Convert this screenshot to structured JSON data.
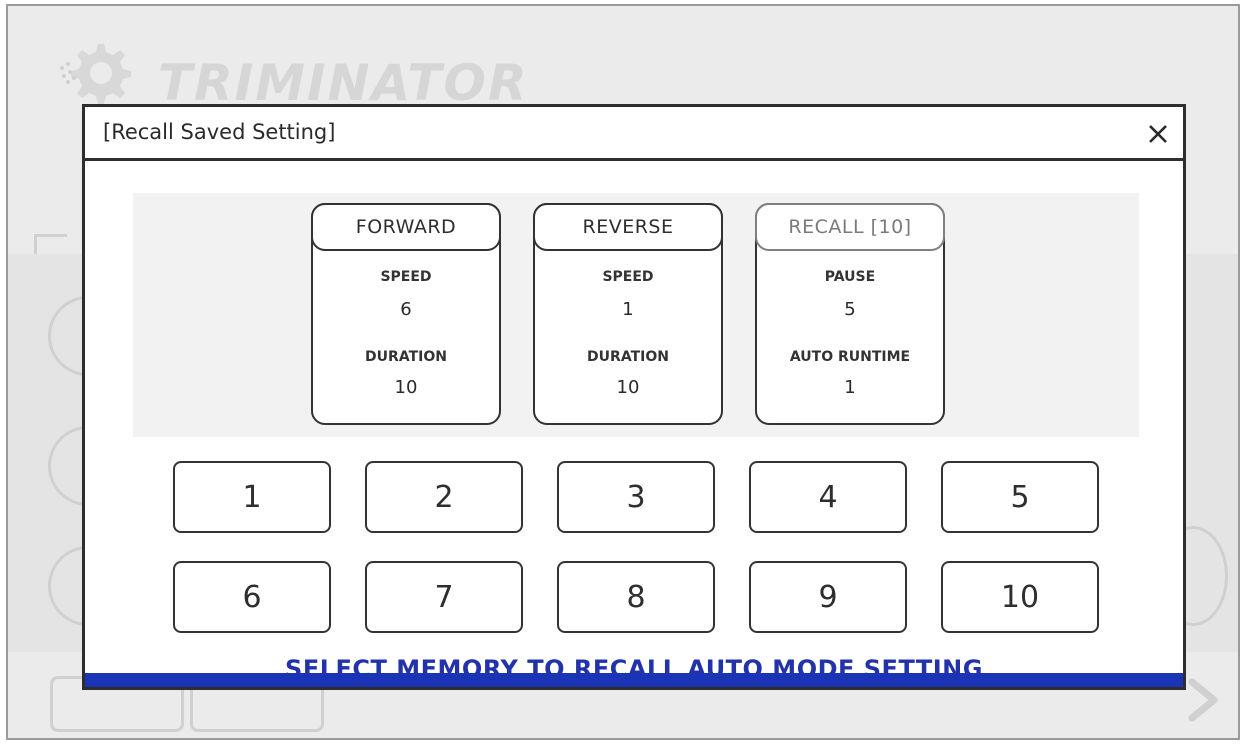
{
  "background": {
    "logo_text": "TRIMINATOR"
  },
  "dialog": {
    "title": "[Recall Saved Setting]",
    "close_icon": "close-icon",
    "cards": [
      {
        "header": "FORWARD",
        "row1_label": "SPEED",
        "row1_value": "6",
        "row2_label": "DURATION",
        "row2_value": "10"
      },
      {
        "header": "REVERSE",
        "row1_label": "SPEED",
        "row1_value": "1",
        "row2_label": "DURATION",
        "row2_value": "10"
      },
      {
        "header": "RECALL [10]",
        "row1_label": "PAUSE",
        "row1_value": "5",
        "row2_label": "AUTO RUNTIME",
        "row2_value": "1"
      }
    ],
    "memory_buttons": [
      "1",
      "2",
      "3",
      "4",
      "5",
      "6",
      "7",
      "8",
      "9",
      "10"
    ],
    "instruction": "SELECT MEMORY TO RECALL AUTO MODE SETTING",
    "colors": {
      "accent_blue": "#1b33b5",
      "instruction_text": "#2233aa",
      "border": "#2e2e2e"
    }
  }
}
